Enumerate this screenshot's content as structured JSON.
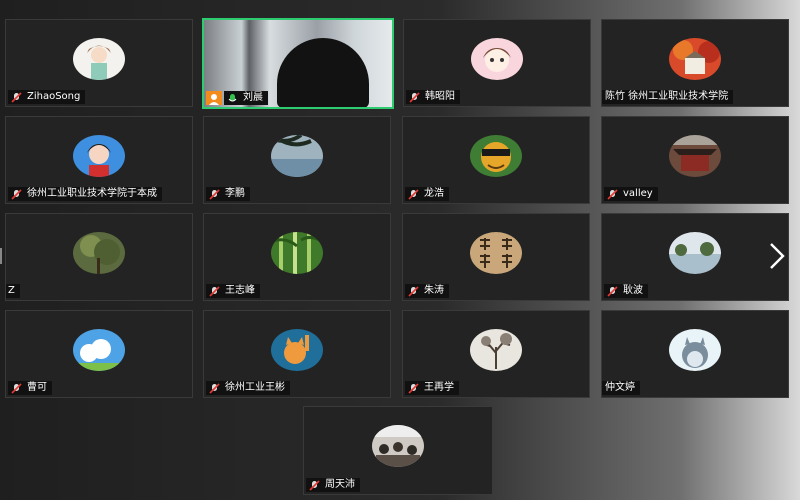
{
  "participants": [
    {
      "name": "ZihaoSong",
      "avatar_theme": "cartoon-boy-icon"
    },
    {
      "name": "刘晨",
      "avatar_theme": "live-video-feed"
    },
    {
      "name": "韩昭阳",
      "avatar_theme": "cartoon-girl-icon"
    },
    {
      "name": "陈竹  徐州工业职业技术学院",
      "avatar_theme": "autumn-building-icon"
    },
    {
      "name": "徐州工业职业技术学院于本成",
      "avatar_theme": "child-portrait-icon"
    },
    {
      "name": "李鹏",
      "avatar_theme": "palm-sea-icon"
    },
    {
      "name": "龙浩",
      "avatar_theme": "cartoon-character-icon"
    },
    {
      "name": "valley",
      "avatar_theme": "temple-icon"
    },
    {
      "name": "Z",
      "avatar_theme": "tree-icon"
    },
    {
      "name": "王志峰",
      "avatar_theme": "bamboo-icon"
    },
    {
      "name": "朱涛",
      "avatar_theme": "calligraphy-icon"
    },
    {
      "name": "耿波",
      "avatar_theme": "lake-icon"
    },
    {
      "name": "曹可",
      "avatar_theme": "sky-icon"
    },
    {
      "name": "徐州工业王彬",
      "avatar_theme": "orange-cat-icon"
    },
    {
      "name": "王再学",
      "avatar_theme": "winter-tree-icon"
    },
    {
      "name": "仲文婷",
      "avatar_theme": "totoro-icon"
    },
    {
      "name": "周天沛",
      "avatar_theme": "classroom-icon"
    }
  ],
  "colors": {
    "tile_bg": "#232323",
    "active_border": "#2ecc71",
    "label_bg": "#111111",
    "cam_badge": "#f28c1c"
  }
}
